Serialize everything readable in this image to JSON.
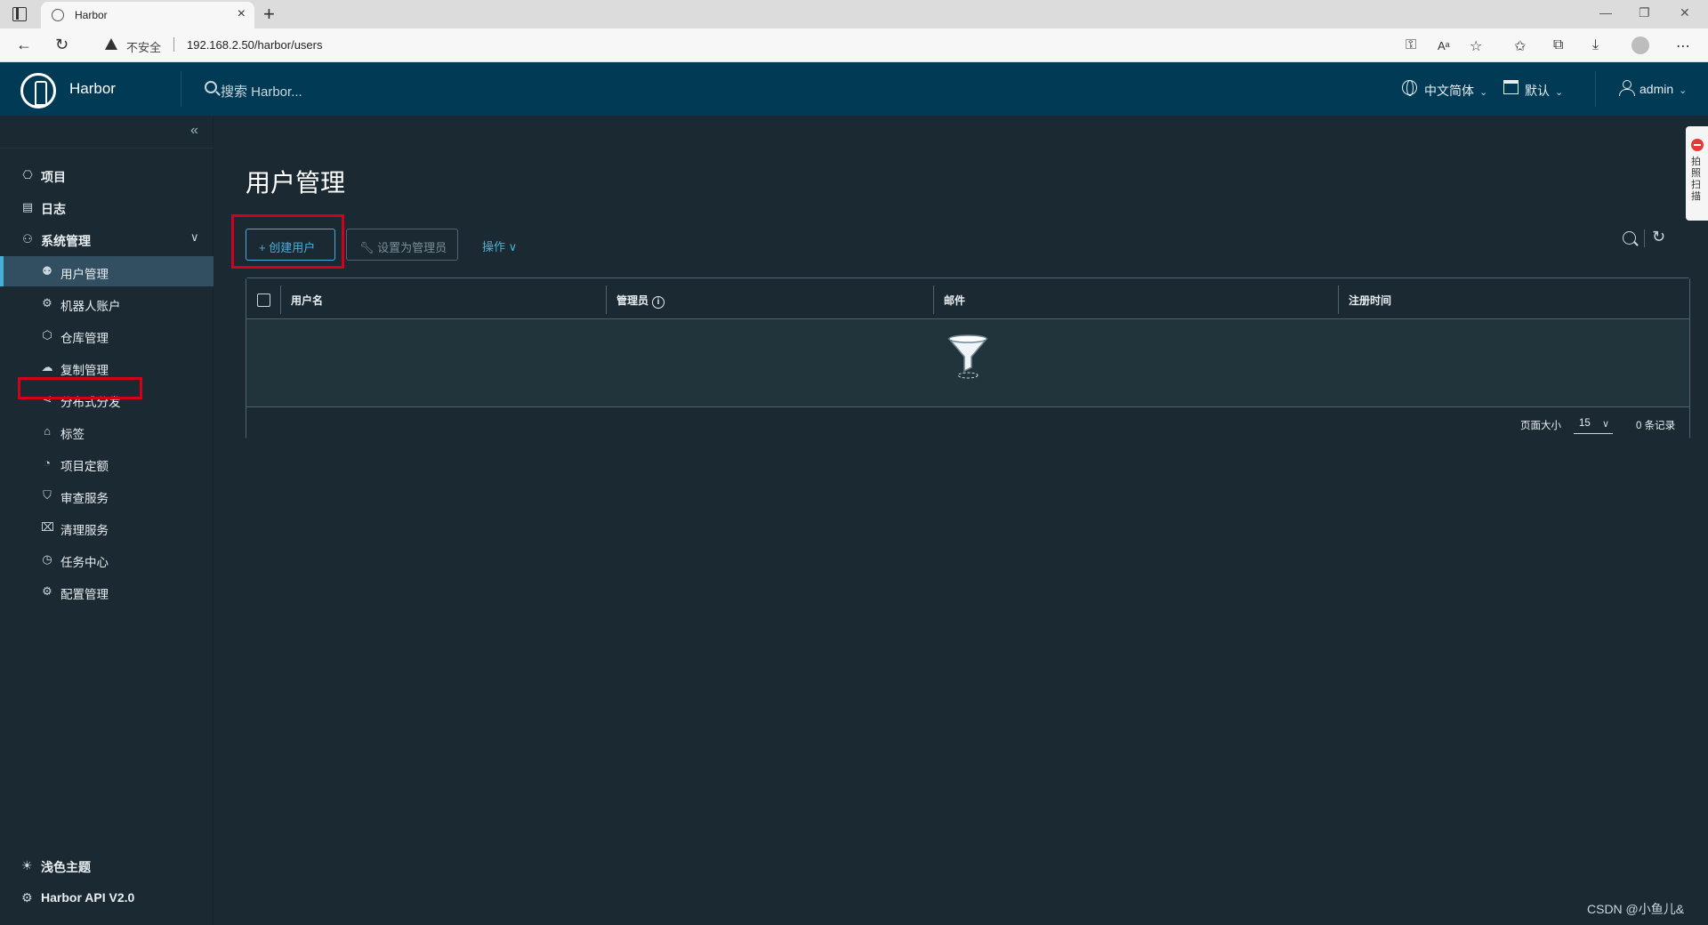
{
  "browser": {
    "tab_title": "Harbor",
    "url_warning": "不安全",
    "url": "192.168.2.50/harbor/users"
  },
  "header": {
    "app_name": "Harbor",
    "search_placeholder": "搜索 Harbor...",
    "language": "中文简体",
    "datetime_format": "默认",
    "user": "admin"
  },
  "sidebar": {
    "items": [
      {
        "label": "项目"
      },
      {
        "label": "日志"
      },
      {
        "label": "系统管理"
      }
    ],
    "admin_items": [
      {
        "label": "用户管理"
      },
      {
        "label": "机器人账户"
      },
      {
        "label": "仓库管理"
      },
      {
        "label": "复制管理"
      },
      {
        "label": "分布式分发"
      },
      {
        "label": "标签"
      },
      {
        "label": "项目定额"
      },
      {
        "label": "审查服务"
      },
      {
        "label": "清理服务"
      },
      {
        "label": "任务中心"
      },
      {
        "label": "配置管理"
      }
    ],
    "theme_toggle": "浅色主题",
    "api_link": "Harbor API V2.0"
  },
  "main": {
    "title": "用户管理",
    "create_user": "+ 创建用户",
    "set_admin": "设置为管理员",
    "operations": "操作",
    "columns": [
      "用户名",
      "管理员",
      "邮件",
      "注册时间"
    ],
    "page_size_label": "页面大小",
    "page_size": "15",
    "total": "0 条记录"
  },
  "widget_text": "拍照扫描",
  "watermark": "CSDN @小鱼儿&",
  "colors": {
    "header_bg": "#003a55",
    "sidebar_bg": "#1b2a32",
    "accent": "#49afd9",
    "highlight": "#d0021b"
  }
}
